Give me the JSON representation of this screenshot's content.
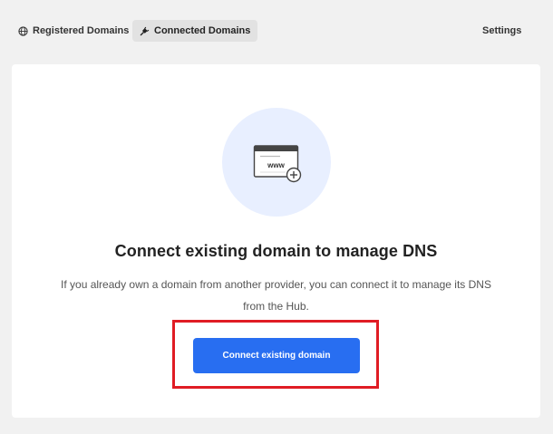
{
  "nav": {
    "tabs": [
      {
        "label": "Registered Domains",
        "icon": "globe-icon",
        "active": false
      },
      {
        "label": "Connected Domains",
        "icon": "plug-icon",
        "active": true
      }
    ],
    "settings_label": "Settings"
  },
  "empty_state": {
    "illustration_icon": "www-browser-icon",
    "illustration_text": "www",
    "title": "Connect existing domain to manage DNS",
    "description": "If you already own a domain from another provider, you can connect it to manage its DNS from the Hub.",
    "cta_label": "Connect existing domain"
  },
  "colors": {
    "page_background": "#f1f1f1",
    "card_background": "#ffffff",
    "active_tab_background": "#e2e2e2",
    "primary_button": "#286ef1",
    "illustration_circle": "#e8efff",
    "highlight_border": "#e01c24"
  }
}
